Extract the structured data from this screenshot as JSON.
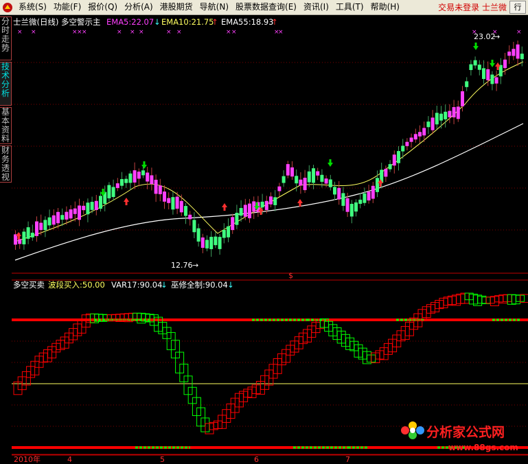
{
  "menu": {
    "items": [
      "系统(S)",
      "功能(F)",
      "报价(Q)",
      "分析(A)",
      "港股期货",
      "导航(N)",
      "股票数据查询(E)",
      "资讯(I)",
      "工具(T)",
      "帮助(H)"
    ],
    "status": "交易未登录  士兰微",
    "row_button": "行"
  },
  "side_tabs": [
    {
      "label": "分时走势",
      "active": false
    },
    {
      "label": "技术分析",
      "active": true
    },
    {
      "label": "基本资料",
      "active": false
    },
    {
      "label": "财务透视",
      "active": false
    }
  ],
  "main_panel": {
    "title": "士兰微(日线)",
    "indicator": "多空警示主",
    "ema5": "EMA5:22.07",
    "ema10": "EMA10:21.75",
    "ema55": "EMA55:18.93",
    "high_label": "23.02",
    "low_label": "12.76",
    "marker": "$"
  },
  "sub_panel": {
    "indicator": "多空买卖",
    "buy_zone": "波段买入:50.00",
    "var17": "VAR17:90.04",
    "full_control": "巫修全制:90.04"
  },
  "date_axis": {
    "labels": [
      "2010年",
      "4",
      "5",
      "6",
      "7"
    ]
  },
  "watermark": {
    "text": "分析家公式网",
    "url": "www.88gs.com"
  },
  "colors": {
    "up_candle": "#ff40ff",
    "down_candle": "#40ff80",
    "sell_arrow": "#00dd00",
    "buy_arrow": "#ff3030",
    "ema5": "#ff40ff",
    "ema10": "#ffff60",
    "ema55": "#ffffff",
    "grid": "#800000",
    "bull_line": "#ff0000",
    "bear_line": "#00ff00"
  }
}
